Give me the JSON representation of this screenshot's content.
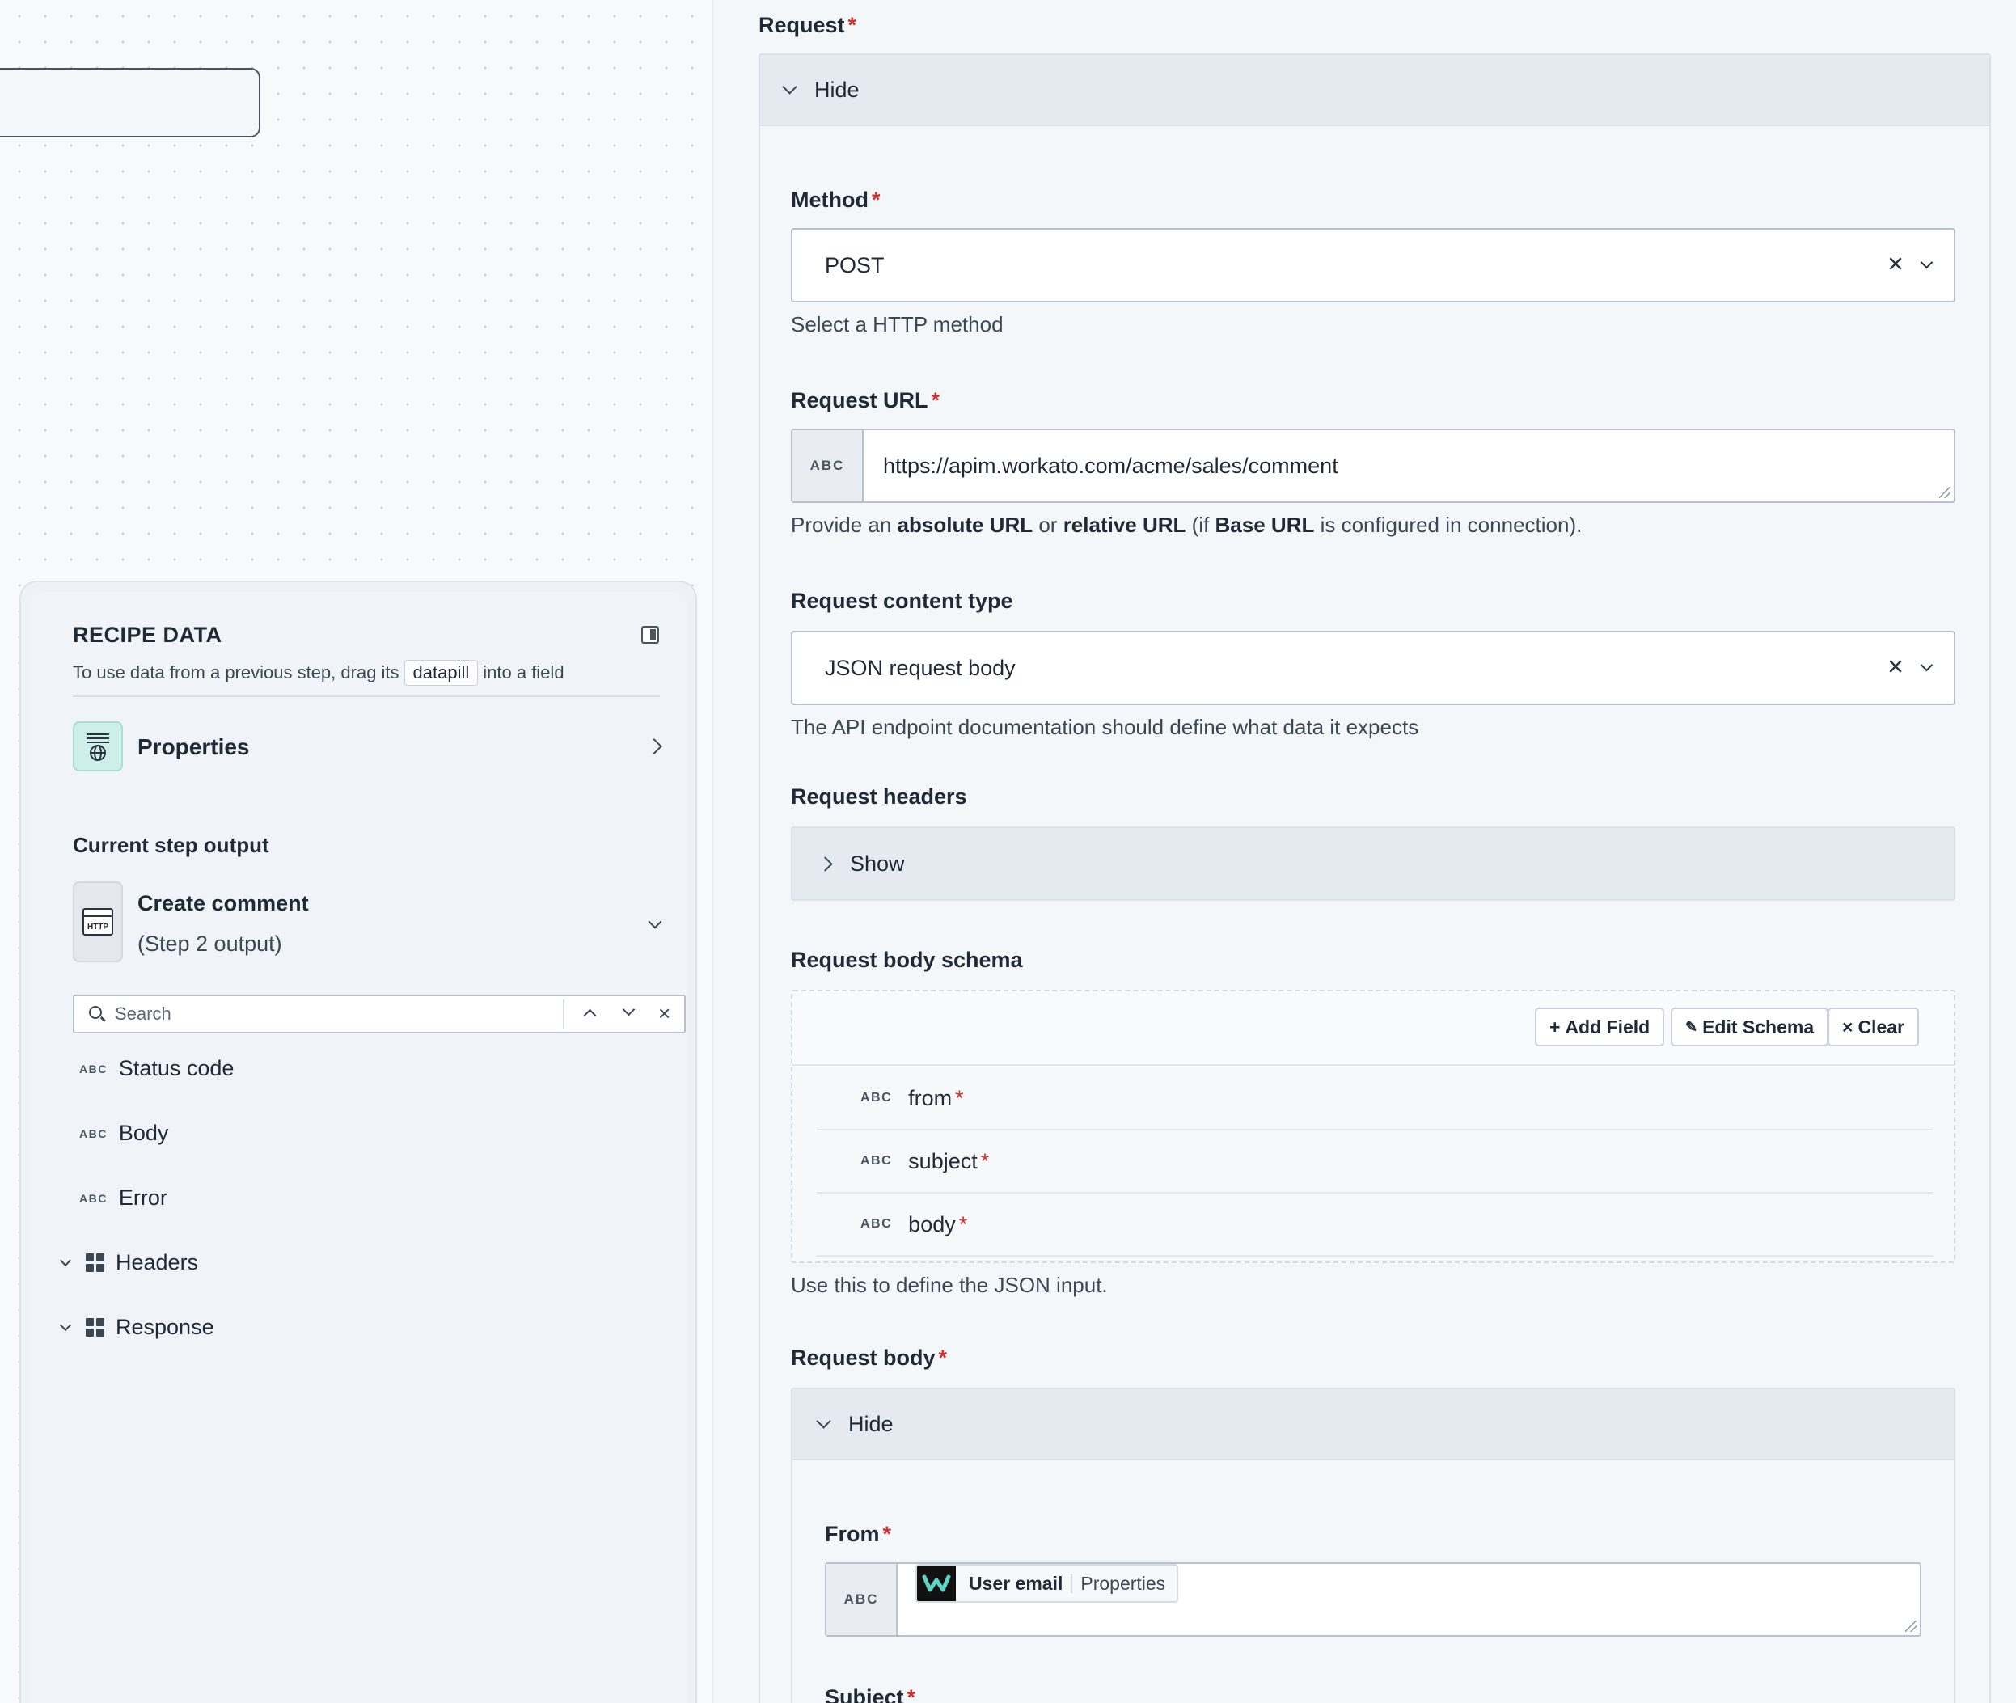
{
  "canvas": {},
  "recipe_data": {
    "title": "RECIPE DATA",
    "subtitle_before": "To use data from a previous step, drag its",
    "pill_word": "datapill",
    "subtitle_after": "into a field",
    "properties_label": "Properties",
    "current_step_title": "Current step output",
    "step": {
      "name": "Create comment",
      "sub": "(Step 2 output)",
      "icon_text": "HTTP"
    },
    "search_placeholder": "Search",
    "outputs": [
      {
        "type": "ABC",
        "label": "Status code"
      },
      {
        "type": "ABC",
        "label": "Body"
      },
      {
        "type": "ABC",
        "label": "Error"
      }
    ],
    "groups": [
      {
        "label": "Headers"
      },
      {
        "label": "Response"
      }
    ]
  },
  "config": {
    "request_label": "Request",
    "request_toggle": "Hide",
    "method": {
      "label": "Method",
      "value": "POST",
      "hint": "Select a HTTP method"
    },
    "url": {
      "label": "Request URL",
      "type": "ABC",
      "value": "https://apim.workato.com/acme/sales/comment",
      "hint_parts": [
        "Provide an ",
        "absolute URL",
        " or ",
        "relative URL",
        " (if ",
        "Base URL",
        " is configured in connection)."
      ]
    },
    "content_type": {
      "label": "Request content type",
      "value": "JSON request body",
      "hint": "The API endpoint documentation should define what data it expects"
    },
    "headers": {
      "label": "Request headers",
      "toggle": "Show"
    },
    "schema": {
      "label": "Request body schema",
      "buttons": {
        "add": "Add Field",
        "edit": "Edit Schema",
        "clear": "Clear"
      },
      "fields": [
        {
          "type": "ABC",
          "name": "from"
        },
        {
          "type": "ABC",
          "name": "subject"
        },
        {
          "type": "ABC",
          "name": "body"
        }
      ],
      "hint": "Use this to define the JSON input."
    },
    "body": {
      "label": "Request body",
      "toggle": "Hide",
      "from_label": "From",
      "from_type": "ABC",
      "pill_name": "User email",
      "pill_source": "Properties",
      "subject_label": "Subject"
    },
    "required_mark": "*"
  }
}
